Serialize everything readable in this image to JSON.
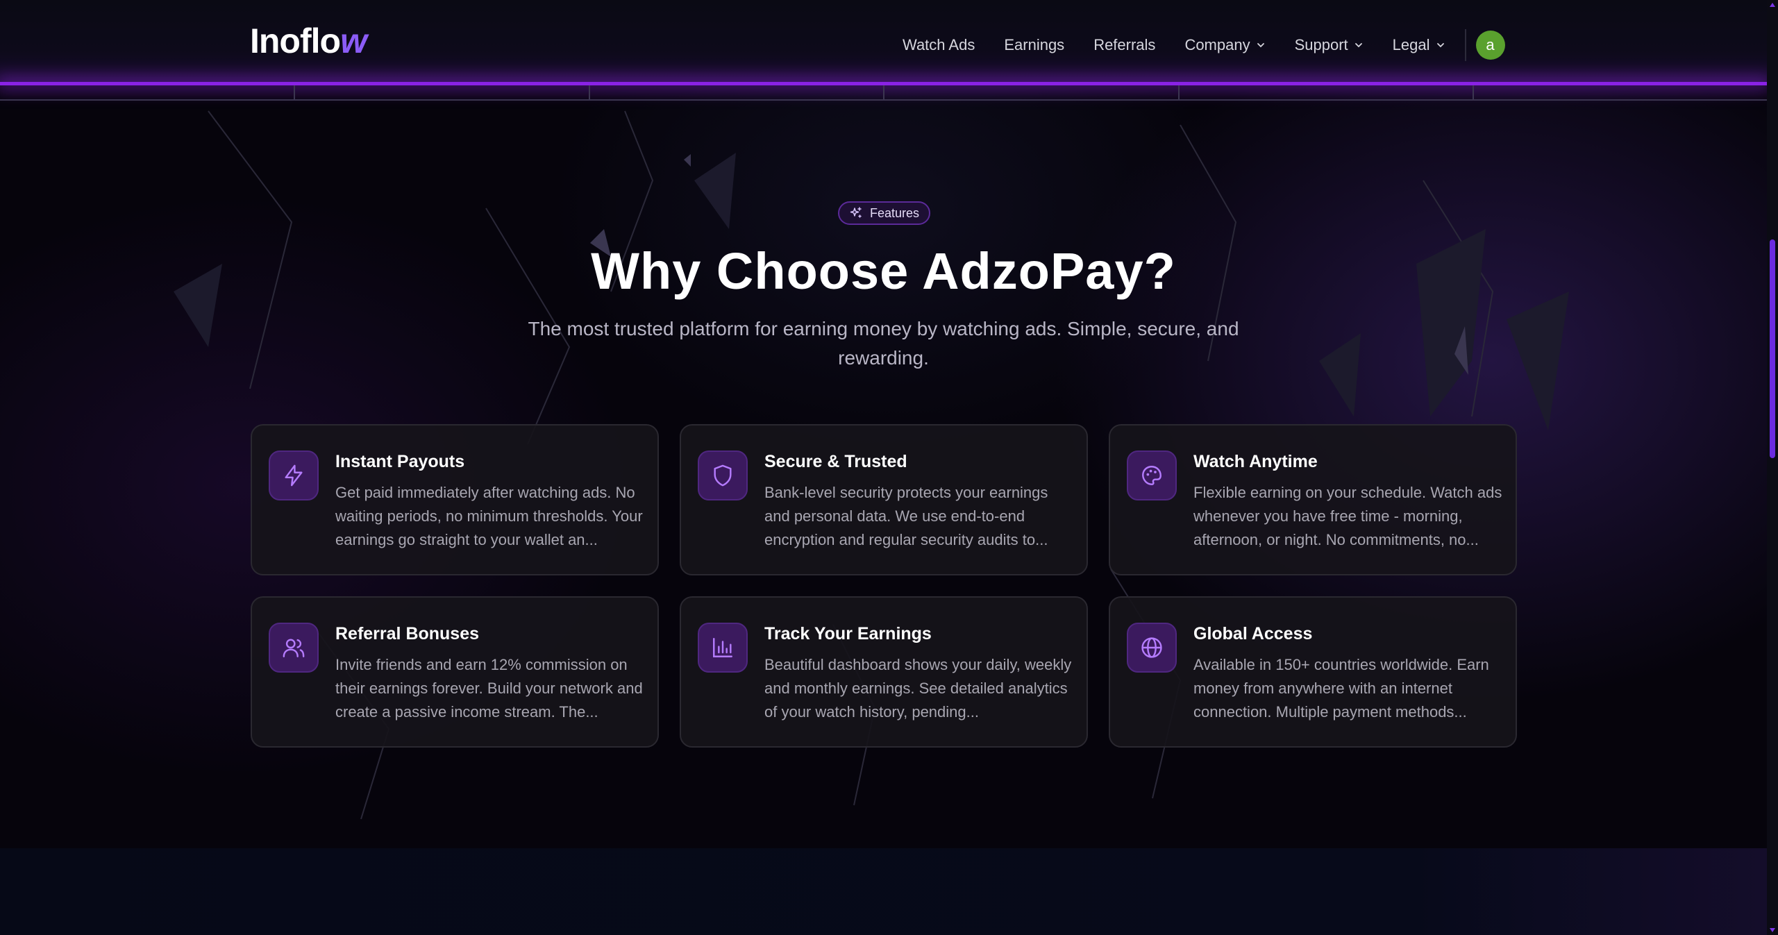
{
  "brand": {
    "logo_text": "Inoflo",
    "logo_accent": "w"
  },
  "nav": {
    "items": [
      {
        "label": "Watch Ads",
        "dropdown": false
      },
      {
        "label": "Earnings",
        "dropdown": false
      },
      {
        "label": "Referrals",
        "dropdown": false
      },
      {
        "label": "Company",
        "dropdown": true
      },
      {
        "label": "Support",
        "dropdown": true
      },
      {
        "label": "Legal",
        "dropdown": true
      }
    ],
    "avatar_initial": "a"
  },
  "hero": {
    "badge": "Features",
    "badge_icon": "sparkles-icon",
    "title": "Why Choose AdzoPay?",
    "subtitle": "The most trusted platform for earning money by watching ads. Simple, secure, and rewarding."
  },
  "features": [
    {
      "icon": "lightning-icon",
      "title": "Instant Payouts",
      "description": "Get paid immediately after watching ads. No waiting periods, no minimum thresholds. Your earnings go straight to your wallet an..."
    },
    {
      "icon": "shield-icon",
      "title": "Secure & Trusted",
      "description": "Bank-level security protects your earnings and personal data. We use end-to-end encryption and regular security audits to..."
    },
    {
      "icon": "palette-icon",
      "title": "Watch Anytime",
      "description": "Flexible earning on your schedule. Watch ads whenever you have free time - morning, afternoon, or night. No commitments, no..."
    },
    {
      "icon": "users-icon",
      "title": "Referral Bonuses",
      "description": "Invite friends and earn 12% commission on their earnings forever. Build your network and create a passive income stream. The..."
    },
    {
      "icon": "bar-chart-icon",
      "title": "Track Your Earnings",
      "description": "Beautiful dashboard shows your daily, weekly and monthly earnings. See detailed analytics of your watch history, pending..."
    },
    {
      "icon": "globe-icon",
      "title": "Global Access",
      "description": "Available in 150+ countries worldwide. Earn money from anywhere with an internet connection. Multiple payment methods..."
    }
  ],
  "colors": {
    "accent": "#8a22e6",
    "icon_tile": "#3b1a5e",
    "avatar": "#5aa12e"
  }
}
